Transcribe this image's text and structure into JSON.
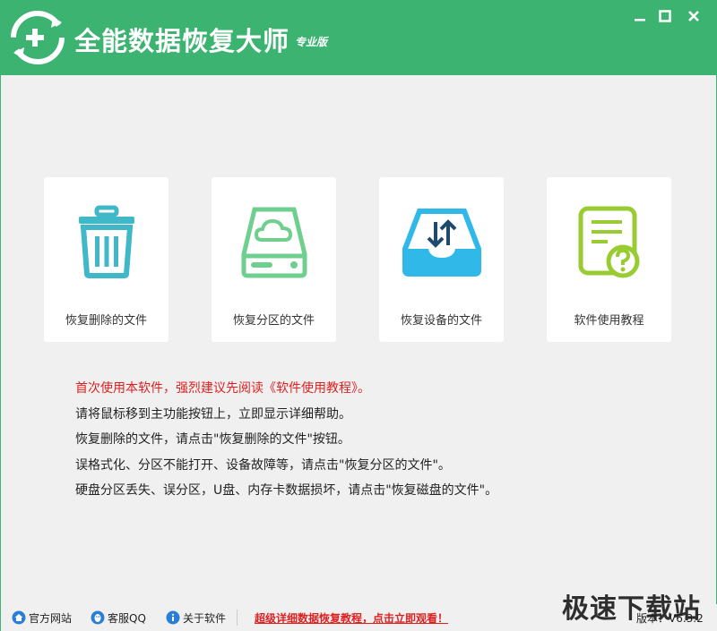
{
  "app": {
    "title": "全能数据恢复大师",
    "edition": "专业版"
  },
  "colors": {
    "brand_green": "#3cb371",
    "trash_teal": "#40b8c8",
    "drive_green": "#6fcf8f",
    "device_blue": "#2fb8e8",
    "tutorial_lime": "#99cc33",
    "warning_red": "#e02020"
  },
  "window_controls": {
    "minimize_icon": "minimize-icon",
    "maximize_icon": "maximize-icon",
    "close_icon": "close-icon"
  },
  "cards": [
    {
      "label": "恢复删除的文件",
      "icon": "trash-can-icon"
    },
    {
      "label": "恢复分区的文件",
      "icon": "cloud-drive-icon"
    },
    {
      "label": "恢复设备的文件",
      "icon": "device-tray-icon"
    },
    {
      "label": "软件使用教程",
      "icon": "document-help-icon"
    }
  ],
  "help": {
    "lines": [
      "首次使用本软件，强烈建议先阅读《软件使用教程》。",
      "请将鼠标移到主功能按钮上，立即显示详细帮助。",
      "恢复删除的文件，请点击\"恢复删除的文件\"按钮。",
      "误格式化、分区不能打开、设备故障等，请点击\"恢复分区的文件\"。",
      "硬盘分区丢失、误分区，U盘、内存卡数据损坏，请点击\"恢复磁盘的文件\"。"
    ]
  },
  "statusbar": {
    "official_site": "官方网站",
    "customer_qq": "客服QQ",
    "about": "关于软件",
    "promo": "超级详细数据恢复教程，点击立即观看！",
    "version": "版本：V6.3.2"
  },
  "watermark": "极速下载站"
}
